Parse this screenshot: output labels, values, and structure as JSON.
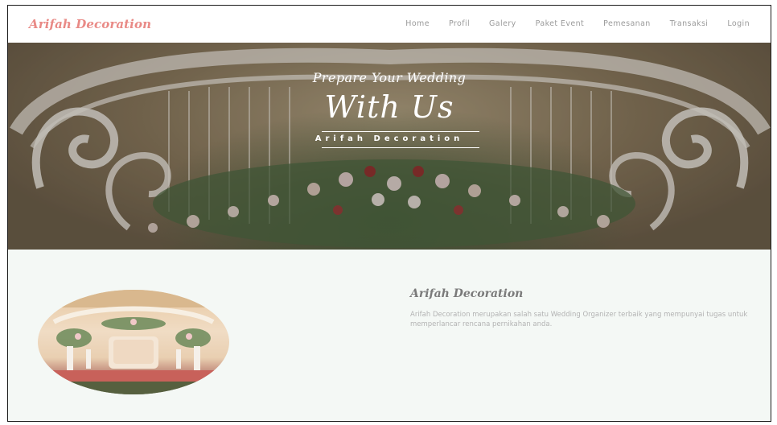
{
  "navbar": {
    "brand": "Arifah Decoration",
    "links": [
      "Home",
      "Profil",
      "Galery",
      "Paket Event",
      "Pemesanan",
      "Transaksi",
      "Login"
    ]
  },
  "hero": {
    "line1": "Prepare Your Wedding",
    "line2": "With Us",
    "subtitle": "Arifah Decoration"
  },
  "about": {
    "title": "Arifah Decoration",
    "description": "Arifah Decoration merupakan salah satu Wedding Organizer terbaik yang mempunyai tugas untuk memperlancar rencana pernikahan anda."
  },
  "colors": {
    "brand": "#e98a86",
    "nav_text": "#9a9a9a",
    "section_bg": "#f4f8f5"
  }
}
